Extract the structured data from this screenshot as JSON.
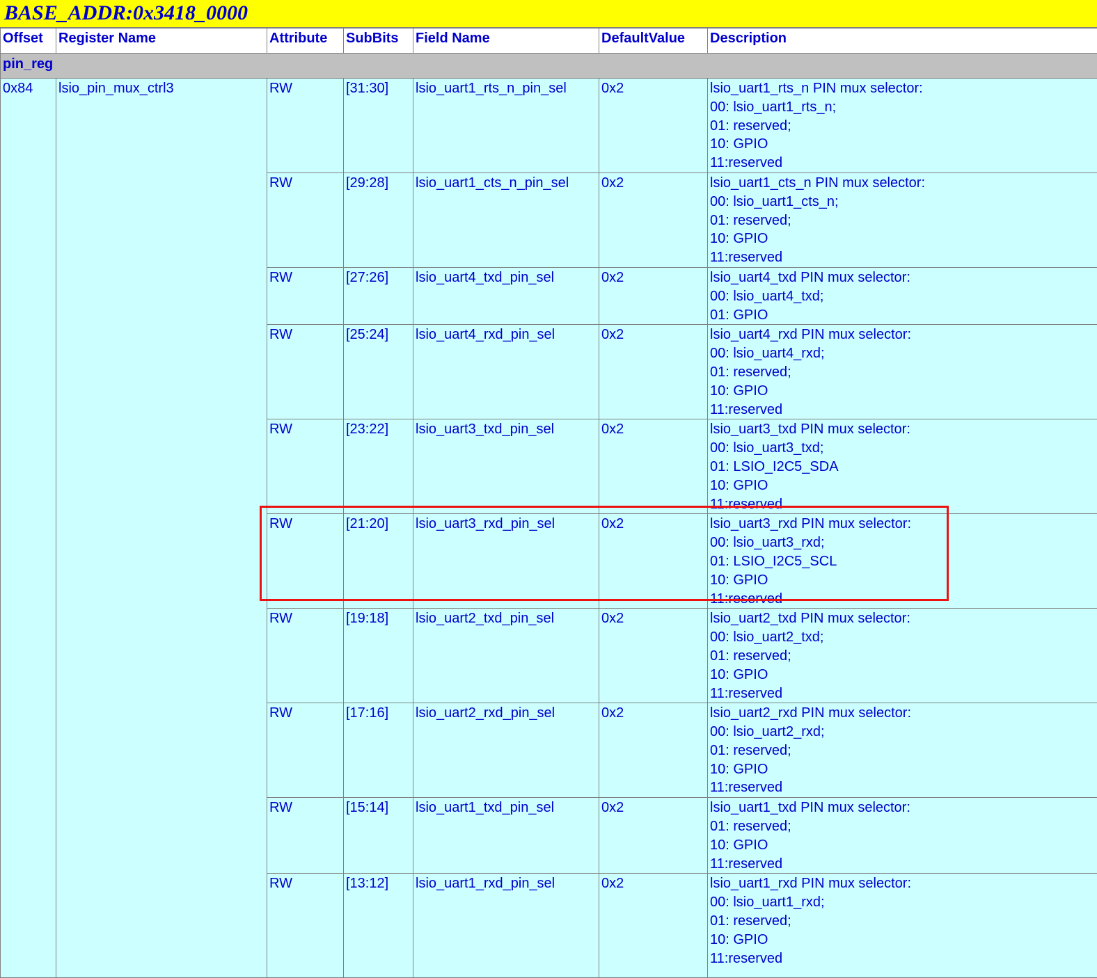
{
  "title": "BASE_ADDR:0x3418_0000",
  "columns": [
    "Offset",
    "Register Name",
    "Attribute",
    "SubBits",
    "Field Name",
    "DefaultValue",
    "Description"
  ],
  "group": "pin_reg",
  "register": {
    "offset": "0x84",
    "name": "lsio_pin_mux_ctrl3"
  },
  "fields": [
    {
      "attr": "RW",
      "bits": "[31:30]",
      "name": "lsio_uart1_rts_n_pin_sel",
      "default": "0x2",
      "desc": [
        "lsio_uart1_rts_n PIN mux selector:",
        "00: lsio_uart1_rts_n;",
        "01: reserved;",
        "10: GPIO",
        "11:reserved"
      ]
    },
    {
      "attr": "RW",
      "bits": "[29:28]",
      "name": "lsio_uart1_cts_n_pin_sel",
      "default": "0x2",
      "desc": [
        "lsio_uart1_cts_n PIN mux selector:",
        "00: lsio_uart1_cts_n;",
        "01: reserved;",
        "10: GPIO",
        "11:reserved"
      ]
    },
    {
      "attr": "RW",
      "bits": "[27:26]",
      "name": "lsio_uart4_txd_pin_sel",
      "default": "0x2",
      "desc": [
        "lsio_uart4_txd PIN mux selector:",
        "00: lsio_uart4_txd;",
        "01: GPIO"
      ]
    },
    {
      "attr": "RW",
      "bits": "[25:24]",
      "name": "lsio_uart4_rxd_pin_sel",
      "default": "0x2",
      "desc": [
        "lsio_uart4_rxd PIN mux selector:",
        "00: lsio_uart4_rxd;",
        "01: reserved;",
        "10: GPIO",
        "11:reserved"
      ]
    },
    {
      "attr": "RW",
      "bits": "[23:22]",
      "name": "lsio_uart3_txd_pin_sel",
      "default": "0x2",
      "desc": [
        "lsio_uart3_txd PIN mux selector:",
        "00: lsio_uart3_txd;",
        "01: LSIO_I2C5_SDA",
        "10: GPIO",
        "11:reserved"
      ]
    },
    {
      "attr": "RW",
      "bits": "[21:20]",
      "name": "lsio_uart3_rxd_pin_sel",
      "default": "0x2",
      "desc": [
        "lsio_uart3_rxd PIN mux selector:",
        "00: lsio_uart3_rxd;",
        "01: LSIO_I2C5_SCL",
        "10: GPIO",
        "11:reserved"
      ]
    },
    {
      "attr": "RW",
      "bits": "[19:18]",
      "name": "lsio_uart2_txd_pin_sel",
      "default": "0x2",
      "desc": [
        "lsio_uart2_txd PIN mux selector:",
        "00: lsio_uart2_txd;",
        "01: reserved;",
        "10: GPIO",
        "11:reserved"
      ]
    },
    {
      "attr": "RW",
      "bits": "[17:16]",
      "name": "lsio_uart2_rxd_pin_sel",
      "default": "0x2",
      "desc": [
        "lsio_uart2_rxd PIN mux selector:",
        "00: lsio_uart2_rxd;",
        "01: reserved;",
        "10: GPIO",
        "11:reserved"
      ]
    },
    {
      "attr": "RW",
      "bits": "[15:14]",
      "name": "lsio_uart1_txd_pin_sel",
      "default": "0x2",
      "desc": [
        "lsio_uart1_txd PIN mux selector:",
        "01: reserved;",
        "10: GPIO",
        "11:reserved"
      ]
    },
    {
      "attr": "RW",
      "bits": "[13:12]",
      "name": "lsio_uart1_rxd_pin_sel",
      "default": "0x2",
      "desc": [
        "lsio_uart1_rxd PIN mux selector:",
        "00: lsio_uart1_rxd;",
        "01: reserved;",
        "10: GPIO",
        "11:reserved"
      ]
    }
  ],
  "highlight_color": "#ee1111"
}
